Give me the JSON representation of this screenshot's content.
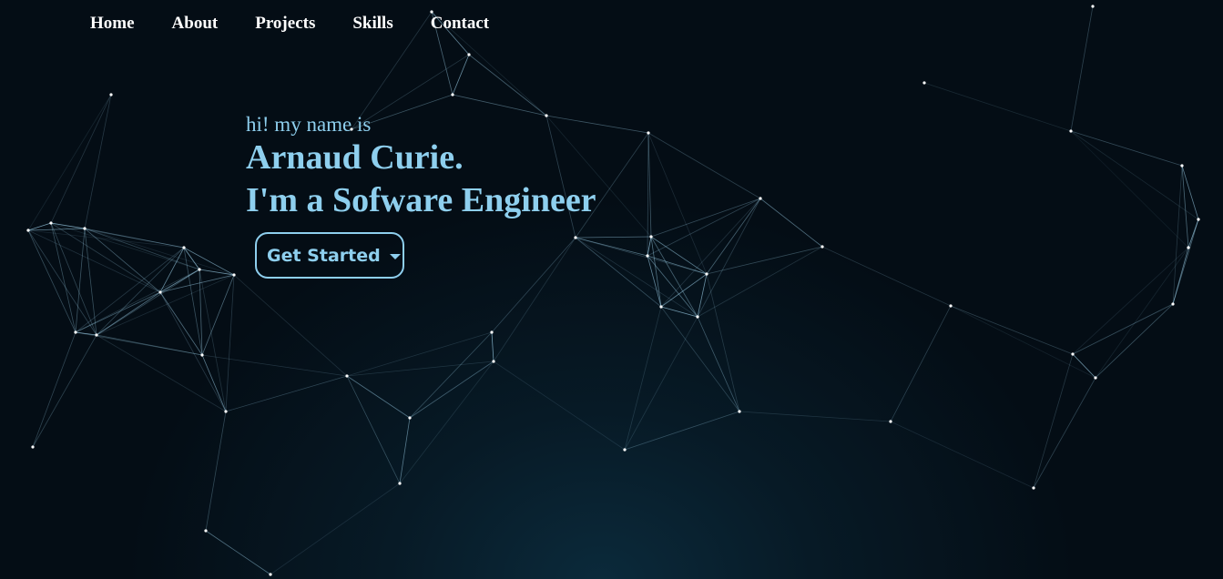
{
  "nav": {
    "items": [
      {
        "label": "Home"
      },
      {
        "label": "About"
      },
      {
        "label": "Projects"
      },
      {
        "label": "Skills"
      },
      {
        "label": "Contact"
      }
    ]
  },
  "hero": {
    "greeting": "hi! my name is",
    "name": "Arnaud Curie.",
    "role": "I'm a Sofware Engineer",
    "cta_label": "Get Started"
  },
  "colors": {
    "accent": "#8ecfee",
    "nav_text": "#ffffff",
    "background": "#040c14",
    "network_line": "#9fd3ec"
  }
}
